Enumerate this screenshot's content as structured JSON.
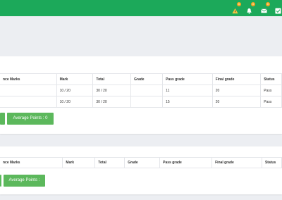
{
  "topbar": {
    "icons": [
      {
        "name": "warning-icon",
        "badge": "0"
      },
      {
        "name": "bell-icon",
        "badge": "0"
      },
      {
        "name": "mail-icon",
        "badge": "0"
      },
      {
        "name": "checkbox-icon"
      }
    ],
    "color": "#1ca95a",
    "badge_color": "#f5a623"
  },
  "table1": {
    "headers": [
      "nce Marks",
      "Mark",
      "Total",
      "Grade",
      "Pass grade",
      "Final grade",
      "Status"
    ],
    "rows": [
      [
        "",
        "10 / 20",
        "30 / 20",
        "",
        "11",
        "20",
        "Pass"
      ],
      [
        "",
        "10 / 20",
        "30 / 20",
        "",
        "15",
        "20",
        "Pass"
      ]
    ],
    "average_button": "Average Points : 0"
  },
  "table2": {
    "headers": [
      "nce Marks",
      "Mark",
      "Total",
      "Grade",
      "Pass grade",
      "Final grade",
      "Status"
    ],
    "rows": [],
    "average_button": "Average Points :"
  },
  "colors": {
    "button": "#5cb85c",
    "background": "#eceef2"
  }
}
